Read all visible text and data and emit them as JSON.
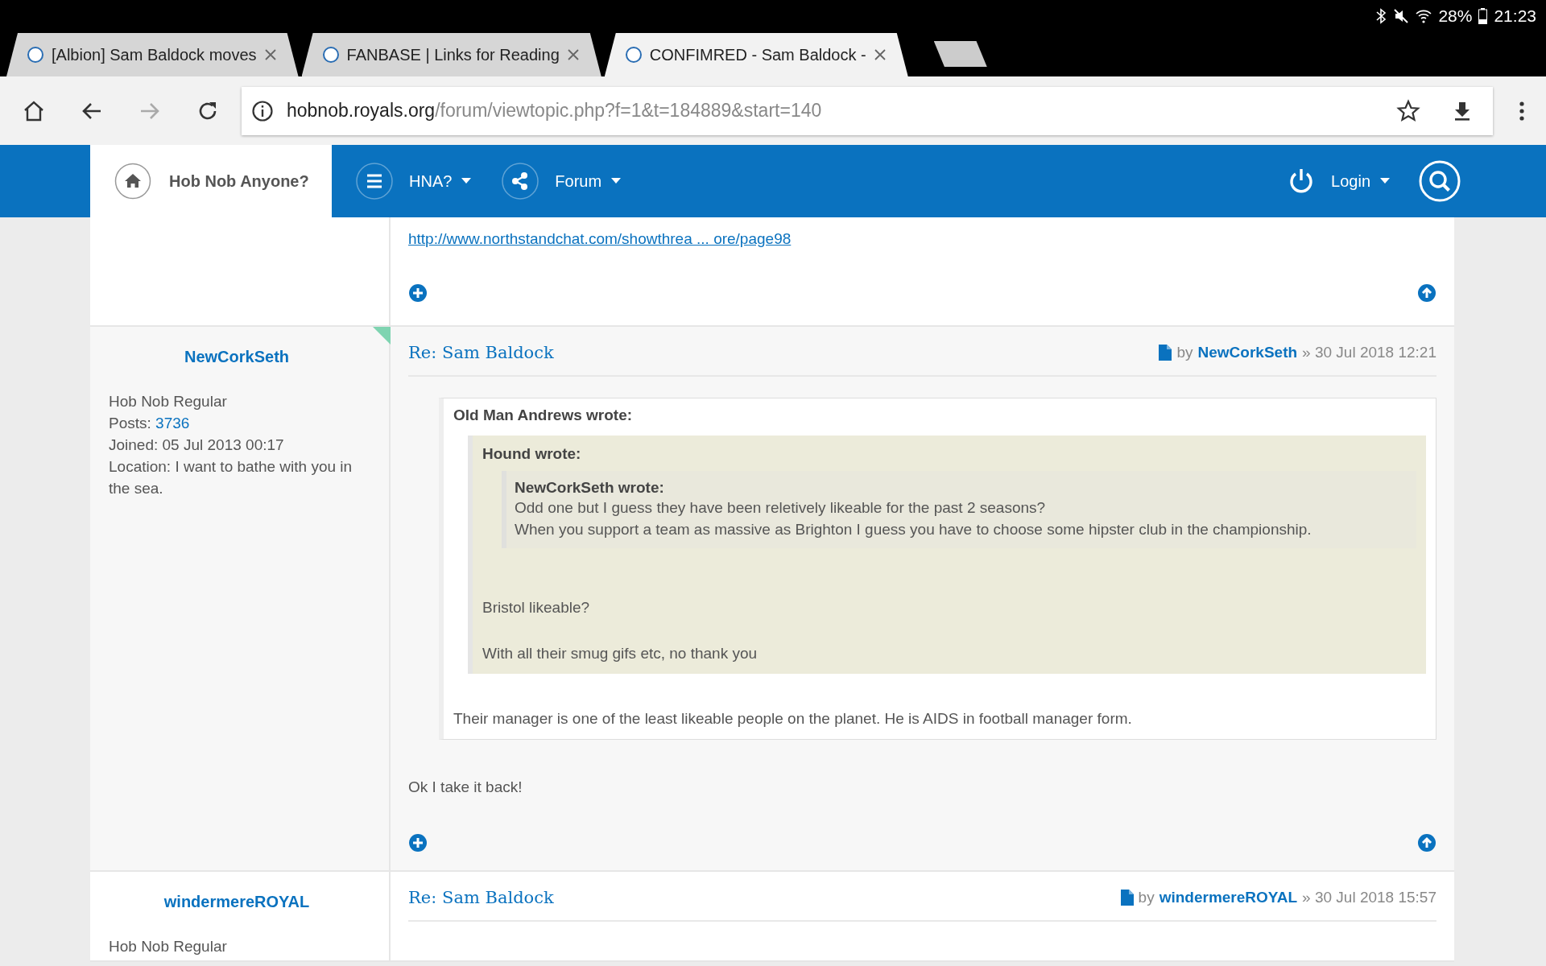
{
  "status_bar": {
    "battery": "28%",
    "time": "21:23"
  },
  "tabs": [
    {
      "title": "[Albion] Sam Baldock moves",
      "selected": false
    },
    {
      "title": "FANBASE | Links for Reading",
      "selected": false
    },
    {
      "title": "CONFIMRED - Sam Baldock -",
      "selected": true
    }
  ],
  "toolbar": {
    "url_host": "hobnob.royals.org",
    "url_path": "/forum/viewtopic.php?f=1&t=184889&start=140"
  },
  "nav": {
    "site_title": "Hob Nob Anyone?",
    "menus": [
      {
        "label": "HNA?",
        "kind": "menu"
      },
      {
        "label": "Forum",
        "kind": "share"
      }
    ],
    "login": "Login"
  },
  "posts": [
    {
      "link": "http://www.northstandchat.com/showthrea ... ore/page98",
      "online": false
    },
    {
      "author": "NewCorkSeth",
      "online": true,
      "rank": "Hob Nob Regular",
      "posts_label": "Posts:",
      "posts": "3736",
      "joined": "Joined: 05 Jul 2013 00:17",
      "location": "Location: I want to bathe with you in the sea.",
      "title": "Re: Sam Baldock",
      "by": "by",
      "by_author": "NewCorkSeth",
      "date": "» 30 Jul 2018 12:21",
      "quote": {
        "author": "Old Man Andrews wrote:",
        "quote": {
          "author": "Hound wrote:",
          "quote": {
            "author": "NewCorkSeth wrote:",
            "paragraphs": [
              "Odd one but I guess they have been reletively likeable for the past 2 seasons?\nWhen you support a team as massive as Brighton I guess you have to choose some hipster club in the championship."
            ]
          },
          "paragraphs": [
            "Bristol likeable?",
            "With all their smug gifs etc, no thank you"
          ]
        },
        "paragraphs": [
          "Their manager is one of the least likeable people on the planet. He is AIDS in football manager form."
        ]
      },
      "text": "Ok I take it back!"
    },
    {
      "author": "windermereROYAL",
      "online": false,
      "rank": "Hob Nob Regular",
      "title": "Re: Sam Baldock",
      "by": "by",
      "by_author": "windermereROYAL",
      "date": "» 30 Jul 2018 15:57"
    }
  ]
}
